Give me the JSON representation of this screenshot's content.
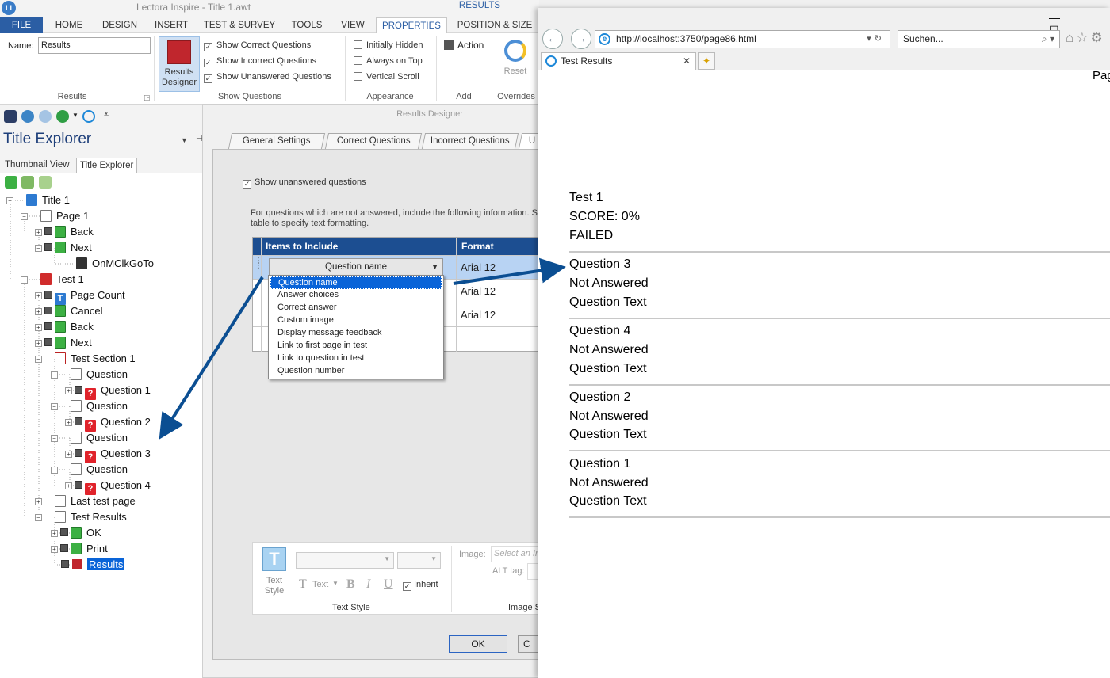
{
  "app": {
    "title": "Lectora Inspire - Title 1.awt",
    "context_tab": "RESULTS",
    "logo": "LI"
  },
  "menu": [
    "FILE",
    "HOME",
    "DESIGN",
    "INSERT",
    "TEST & SURVEY",
    "TOOLS",
    "VIEW",
    "PROPERTIES",
    "POSITION & SIZE"
  ],
  "ribbon": {
    "name_label": "Name:",
    "name_value": "Results",
    "results_group_label": "Results",
    "designer_button": "Results Designer",
    "show_questions": {
      "label": "Show Questions",
      "items": [
        {
          "label": "Show Correct Questions",
          "checked": true
        },
        {
          "label": "Show Incorrect Questions",
          "checked": true
        },
        {
          "label": "Show Unanswered Questions",
          "checked": true
        }
      ]
    },
    "appearance": {
      "label": "Appearance",
      "items": [
        {
          "label": "Initially Hidden",
          "checked": false
        },
        {
          "label": "Always on Top",
          "checked": false
        },
        {
          "label": "Vertical Scroll",
          "checked": false
        }
      ]
    },
    "add": {
      "label": "Add",
      "action": "Action"
    },
    "overrides": {
      "label": "Overrides",
      "reset": "Reset"
    }
  },
  "explorer": {
    "title": "Title Explorer",
    "tabs": [
      "Thumbnail View",
      "Title Explorer"
    ],
    "tree": [
      {
        "label": "Title 1",
        "icon": "book-icon"
      },
      {
        "label": "Page 1",
        "icon": "page-icon"
      },
      {
        "label": "Back",
        "icon": "button-icon"
      },
      {
        "label": "Next",
        "icon": "button-icon"
      },
      {
        "label": "OnMClkGoTo",
        "icon": "action-icon"
      },
      {
        "label": "Test 1",
        "icon": "test-icon"
      },
      {
        "label": "Page Count",
        "icon": "text-icon"
      },
      {
        "label": "Cancel",
        "icon": "button-icon"
      },
      {
        "label": "Back",
        "icon": "button-icon"
      },
      {
        "label": "Next",
        "icon": "button-icon"
      },
      {
        "label": "Test Section 1",
        "icon": "section-icon"
      },
      {
        "label": "Question",
        "icon": "page-icon"
      },
      {
        "label": "Question 1",
        "icon": "question-icon"
      },
      {
        "label": "Question",
        "icon": "page-icon"
      },
      {
        "label": "Question 2",
        "icon": "question-icon"
      },
      {
        "label": "Question",
        "icon": "page-icon"
      },
      {
        "label": "Question 3",
        "icon": "question-icon"
      },
      {
        "label": "Question",
        "icon": "page-icon"
      },
      {
        "label": "Question 4",
        "icon": "question-icon"
      },
      {
        "label": "Last test page",
        "icon": "page-icon"
      },
      {
        "label": "Test Results",
        "icon": "page-icon"
      },
      {
        "label": "OK",
        "icon": "button-icon"
      },
      {
        "label": "Print",
        "icon": "button-icon"
      },
      {
        "label": "Results",
        "icon": "results-icon"
      }
    ]
  },
  "dialog": {
    "title": "Results Designer",
    "tabs": [
      "General Settings",
      "Correct Questions",
      "Incorrect Questions",
      "U"
    ],
    "show_unanswered": "Show unanswered questions",
    "description": "For questions which are not answered, include the following information. Se table to specify text formatting.",
    "grid": {
      "headers": [
        "Items to Include",
        "Format"
      ],
      "rows": [
        {
          "item": "Question name",
          "format": "Arial 12"
        },
        {
          "item": "",
          "format": "Arial 12"
        },
        {
          "item": "",
          "format": "Arial 12"
        }
      ]
    },
    "dropdown": [
      "Question name",
      "Answer choices",
      "Correct answer",
      "Custom image",
      "Display message feedback",
      "Link to first page in test",
      "Link to question in test",
      "Question number"
    ],
    "text_style": {
      "label": "Text Style",
      "button": "Text Style",
      "text": "Text",
      "inherit": "Inherit",
      "image_label": "Image:",
      "image_placeholder": "Select an Ir",
      "alt_label": "ALT tag:",
      "image_section": "Image S"
    },
    "ok": "OK",
    "cancel": "C"
  },
  "browser": {
    "url": "http://localhost:3750/page86.html",
    "search_placeholder": "Suchen...",
    "tab_title": "Test Results",
    "page_label": "Pag",
    "summary": [
      "Test 1",
      "SCORE: 0%",
      "FAILED"
    ],
    "questions": [
      {
        "name": "Question 3",
        "status": "Not Answered",
        "text": "Question Text"
      },
      {
        "name": "Question 4",
        "status": "Not Answered",
        "text": "Question Text"
      },
      {
        "name": "Question 2",
        "status": "Not Answered",
        "text": "Question Text"
      },
      {
        "name": "Question 1",
        "status": "Not Answered",
        "text": "Question Text"
      }
    ]
  },
  "colors": {
    "accent": "#2b5ea4",
    "grid_header": "#1c4e91",
    "selection": "#0a64d8",
    "arrow": "#0b4e92"
  }
}
